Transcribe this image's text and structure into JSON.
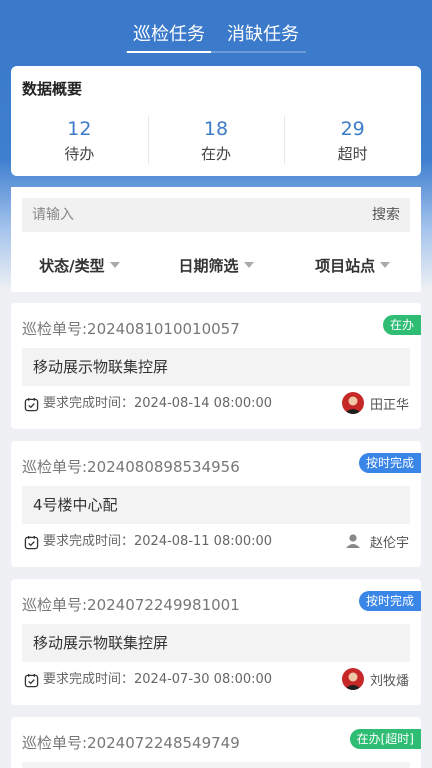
{
  "tabs": [
    {
      "label": "巡检任务",
      "active": true
    },
    {
      "label": "消缺任务",
      "active": false
    }
  ],
  "overview": {
    "title": "数据概要",
    "stats": [
      {
        "value": "12",
        "label": "待办"
      },
      {
        "value": "18",
        "label": "在办"
      },
      {
        "value": "29",
        "label": "超时"
      }
    ]
  },
  "search": {
    "placeholder": "请输入",
    "button": "搜索"
  },
  "filters": [
    {
      "label": "状态/类型"
    },
    {
      "label": "日期筛选"
    },
    {
      "label": "项目站点"
    }
  ],
  "colors": {
    "primary": "#3a78c9",
    "number": "#3d7cc9",
    "badge_green": "#2ebd73",
    "badge_blue": "#3a86e8"
  },
  "tasks": [
    {
      "order_no": "巡检单号:2024081010010057",
      "status": "在办",
      "status_color": "green",
      "project": "移动展示物联集控屏",
      "due": "要求完成时间：2024-08-14 08:00:00",
      "assignee": "田正华",
      "avatar": "photo"
    },
    {
      "order_no": "巡检单号:2024080898534956",
      "status": "按时完成",
      "status_color": "blue",
      "project": "4号楼中心配",
      "due": "要求完成时间：2024-08-11 08:00:00",
      "assignee": "赵伦宇",
      "avatar": "default"
    },
    {
      "order_no": "巡检单号:2024072249981001",
      "status": "按时完成",
      "status_color": "blue",
      "project": "移动展示物联集控屏",
      "due": "要求完成时间：2024-07-30 08:00:00",
      "assignee": "刘牧燔",
      "avatar": "photo"
    },
    {
      "order_no": "巡检单号:2024072248549749",
      "status": "在办[超时]",
      "status_color": "green",
      "project": "",
      "due": "",
      "assignee": "",
      "avatar": "none"
    }
  ]
}
